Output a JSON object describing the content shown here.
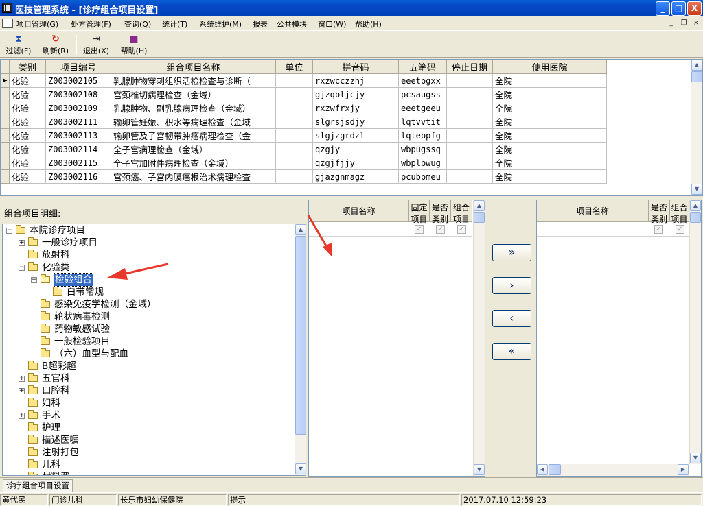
{
  "window": {
    "title": "医技管理系统 - [诊疗组合项目设置]",
    "min": "_",
    "max": "□",
    "close": "X"
  },
  "menu": {
    "items": [
      "项目管理(G)",
      "处方管理(F)",
      "查询(Q)",
      "统计(T)",
      "系统维护(M)",
      "报表",
      "公共模块",
      "窗口(W)",
      "帮助(H)"
    ],
    "mdi_min": "_",
    "mdi_restore": "❐",
    "mdi_close": "×"
  },
  "toolbar": {
    "filter_label": "过滤(F)",
    "refresh_label": "刷新(R)",
    "exit_label": "退出(X)",
    "help_label": "帮助(H)"
  },
  "grid": {
    "columns": [
      "类别",
      "项目编号",
      "组合项目名称",
      "单位",
      "拼音码",
      "五笔码",
      "停止日期",
      "使用医院"
    ],
    "rows": [
      {
        "cat": "化验",
        "code": "Z003002105",
        "name": "乳腺肿物穿刺组织活检检查与诊断（",
        "unit": "",
        "py": "rxzwcczzhj",
        "wb": "eeetpgxx",
        "stop": "",
        "hosp": "全院"
      },
      {
        "cat": "化验",
        "code": "Z003002108",
        "name": "宫颈椎切病理检查（金域）",
        "unit": "",
        "py": "gjzqbljcjy",
        "wb": "pcsaugss",
        "stop": "",
        "hosp": "全院"
      },
      {
        "cat": "化验",
        "code": "Z003002109",
        "name": "乳腺肿物、副乳腺病理检查（金域）",
        "unit": "",
        "py": "rxzwfrxjy",
        "wb": "eeetgeeu",
        "stop": "",
        "hosp": "全院"
      },
      {
        "cat": "化验",
        "code": "Z003002111",
        "name": "输卵管妊娠、积水等病理检查（金域",
        "unit": "",
        "py": "slgrsjsdjy",
        "wb": "lqtvvtit",
        "stop": "",
        "hosp": "全院"
      },
      {
        "cat": "化验",
        "code": "Z003002113",
        "name": "输卵管及子宫韧带肿瘤病理检查（金",
        "unit": "",
        "py": "slgjzgrdzl",
        "wb": "lqtebpfg",
        "stop": "",
        "hosp": "全院"
      },
      {
        "cat": "化验",
        "code": "Z003002114",
        "name": "全子宫病理检查（金域）",
        "unit": "",
        "py": "qzgjy",
        "wb": "wbpugssq",
        "stop": "",
        "hosp": "全院"
      },
      {
        "cat": "化验",
        "code": "Z003002115",
        "name": "全子宫加附件病理检查（金域）",
        "unit": "",
        "py": "qzgjfjjy",
        "wb": "wbplbwug",
        "stop": "",
        "hosp": "全院"
      },
      {
        "cat": "化验",
        "code": "Z003002116",
        "name": "宫颈癌、子宫内膜癌根治术病理检查",
        "unit": "",
        "py": "gjazgnmagz",
        "wb": "pcubpmeu",
        "stop": "",
        "hosp": "全院"
      }
    ]
  },
  "detail": {
    "caption": "组合项目明细:"
  },
  "tree": {
    "nodes": [
      {
        "label": "本院诊疗项目",
        "pm": "−"
      },
      {
        "label": "一般诊疗项目",
        "pm": "+"
      },
      {
        "label": "放射科",
        "pm": ""
      },
      {
        "label": "化验类",
        "pm": "−"
      },
      {
        "label": "检验组合",
        "pm": "−"
      },
      {
        "label": "白带常规",
        "pm": ""
      },
      {
        "label": "感染免疫学检测（金域）",
        "pm": ""
      },
      {
        "label": "轮状病毒检测",
        "pm": ""
      },
      {
        "label": "药物敏感试验",
        "pm": ""
      },
      {
        "label": "一般检验项目",
        "pm": ""
      },
      {
        "label": "（六）血型与配血",
        "pm": ""
      },
      {
        "label": "B超彩超",
        "pm": ""
      },
      {
        "label": "五官科",
        "pm": "+"
      },
      {
        "label": "口腔科",
        "pm": "+"
      },
      {
        "label": "妇科",
        "pm": ""
      },
      {
        "label": "手术",
        "pm": "+"
      },
      {
        "label": "护理",
        "pm": ""
      },
      {
        "label": "描述医嘱",
        "pm": ""
      },
      {
        "label": "注射打包",
        "pm": ""
      },
      {
        "label": "儿科",
        "pm": ""
      },
      {
        "label": "材料费",
        "pm": ""
      }
    ]
  },
  "mid_list": {
    "col_name": "项目名称",
    "col_fixed": [
      "固定",
      "项目"
    ],
    "col_cat": [
      "是否",
      "类别"
    ],
    "col_combo": [
      "组合",
      "项目"
    ],
    "check": "✓"
  },
  "right_list": {
    "col_name": "项目名称",
    "col_cat": [
      "是否",
      "类别"
    ],
    "col_combo": [
      "组合",
      "项目"
    ],
    "check": "✓"
  },
  "move_buttons": {
    "add_all": "»",
    "add_one": "›",
    "remove_one": "‹",
    "remove_all": "«"
  },
  "tabbar": {
    "tab": "诊疗组合项目设置"
  },
  "status": {
    "user": "黄代民",
    "dept": "门诊儿科",
    "org": "长乐市妇幼保健院",
    "hint": "提示",
    "datetime": "2017.07.10 12:59:23"
  },
  "colors": {
    "title_bar": "#0a5fd6",
    "selection": "#316ac5",
    "annotation_arrow": "#e8382c"
  }
}
